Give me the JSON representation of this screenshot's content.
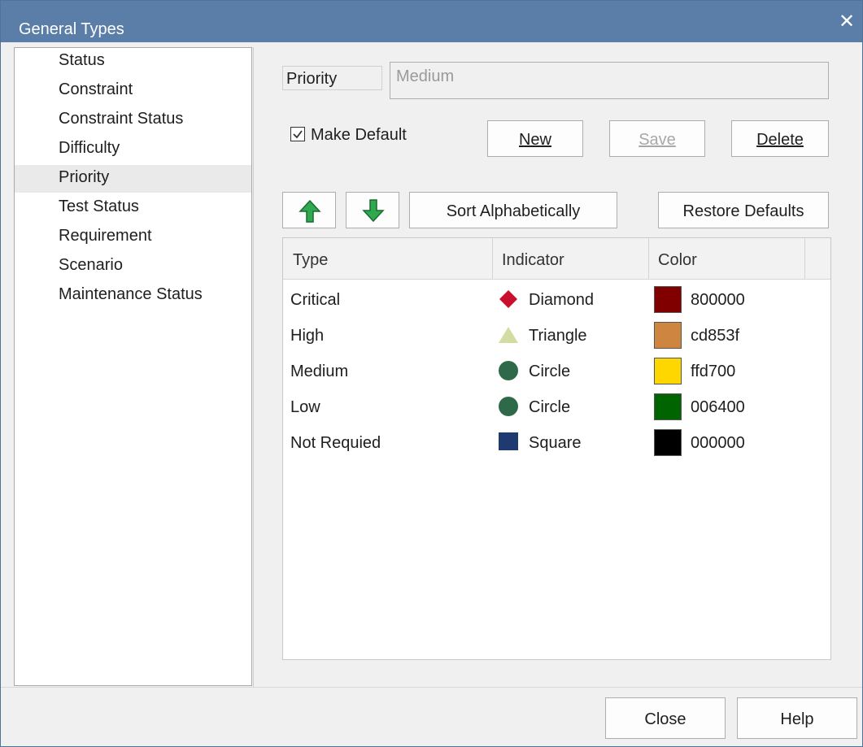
{
  "window": {
    "title": "General Types",
    "close_glyph": "✕"
  },
  "sidebar": {
    "items": [
      {
        "label": "Status"
      },
      {
        "label": "Constraint"
      },
      {
        "label": "Constraint Status"
      },
      {
        "label": "Difficulty"
      },
      {
        "label": "Priority"
      },
      {
        "label": "Test Status"
      },
      {
        "label": "Requirement"
      },
      {
        "label": "Scenario"
      },
      {
        "label": "Maintenance Status"
      }
    ],
    "selected_index": 4
  },
  "form": {
    "name_label": "Priority",
    "name_value": "Medium",
    "make_default_label": "Make Default",
    "make_default_checked": true
  },
  "buttons": {
    "new": "New",
    "save": "Save",
    "delete": "Delete",
    "sort": "Sort Alphabetically",
    "restore": "Restore Defaults",
    "close": "Close",
    "help": "Help",
    "move_up_icon": "green-up-arrow-icon",
    "move_down_icon": "green-down-arrow-icon"
  },
  "table": {
    "columns": [
      "Type",
      "Indicator",
      "Color"
    ],
    "rows": [
      {
        "type": "Critical",
        "indicator": "Diamond",
        "indicator_icon": "diamond",
        "indicator_color": "#c8102e",
        "color_hex": "800000",
        "color": "#800000"
      },
      {
        "type": "High",
        "indicator": "Triangle",
        "indicator_icon": "triangle",
        "indicator_color": "#d4dca3",
        "color_hex": "cd853f",
        "color": "#cd853f"
      },
      {
        "type": "Medium",
        "indicator": "Circle",
        "indicator_icon": "circle",
        "indicator_color": "#2e6a4a",
        "color_hex": "ffd700",
        "color": "#ffd700"
      },
      {
        "type": "Low",
        "indicator": "Circle",
        "indicator_icon": "circle",
        "indicator_color": "#2e6a4a",
        "color_hex": "006400",
        "color": "#006400"
      },
      {
        "type": "Not Requied",
        "indicator": "Square",
        "indicator_icon": "square",
        "indicator_color": "#1f3a70",
        "color_hex": "000000",
        "color": "#000000"
      }
    ]
  },
  "colors": {
    "titlebar": "#5a7ea7",
    "arrow_green": "#2fa84f"
  }
}
